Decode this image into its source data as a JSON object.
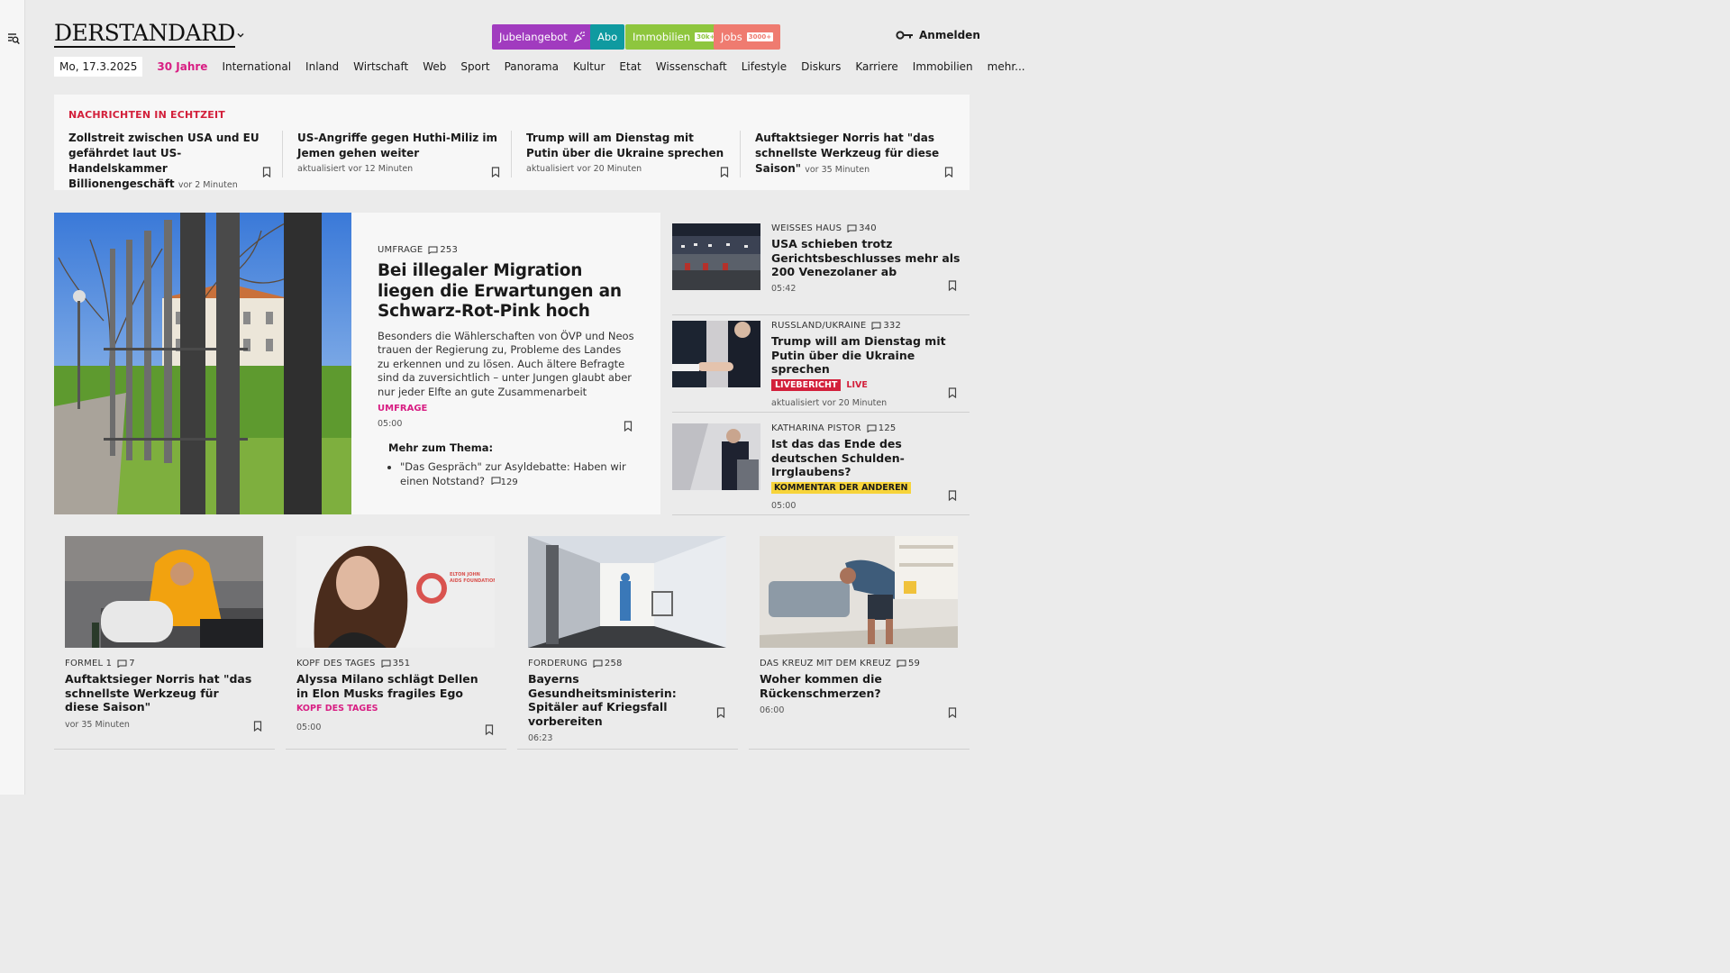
{
  "header": {
    "logo": "DERSTANDARD",
    "promos": [
      {
        "label": "Jubelangebot",
        "badge": "",
        "color": "#a13bbf"
      },
      {
        "label": "Abo",
        "badge": "",
        "color": "#0f9aa0"
      },
      {
        "label": "Immobilien",
        "badge": "30k+",
        "color": "#8ec63e"
      },
      {
        "label": "Jobs",
        "badge": "3000+",
        "color": "#ef7b70"
      }
    ],
    "login_label": "Anmelden"
  },
  "nav": {
    "date": "Mo, 17.3.2025",
    "items": [
      "30 Jahre",
      "International",
      "Inland",
      "Wirtschaft",
      "Web",
      "Sport",
      "Panorama",
      "Kultur",
      "Etat",
      "Wissenschaft",
      "Lifestyle",
      "Diskurs",
      "Karriere",
      "Immobilien",
      "mehr..."
    ]
  },
  "ticker": {
    "heading": "NACHRICHTEN IN ECHTZEIT",
    "items": [
      {
        "title": "Zollstreit zwischen USA und EU gefährdet laut US-Handelskammer Billionengeschäft",
        "time": "vor 2 Minuten"
      },
      {
        "title": "US-Angriffe gegen Huthi-Miliz im Jemen gehen weiter",
        "time": "aktualisiert vor 12 Minuten"
      },
      {
        "title": "Trump will am Dienstag mit Putin über die Ukraine sprechen",
        "time": "aktualisiert vor 20 Minuten"
      },
      {
        "title": "Auftaktsieger Norris hat \"das schnellste Werkzeug für diese Saison\"",
        "time": "vor 35 Minuten"
      }
    ]
  },
  "hero": {
    "kicker": "UMFRAGE",
    "comments": "253",
    "title": "Bei illegaler Migration liegen die Erwartungen an Schwarz-Rot-Pink hoch",
    "teaser": "Besonders die Wählerschaften von ÖVP und Neos trauen der Regierung zu, Probleme des Landes zu erkennen und zu lösen. Auch ältere Befragte sind da zuversichtlich – unter Jungen glaubt aber nur jeder Elfte an gute Zusammenarbeit",
    "tag": "UMFRAGE",
    "time": "05:00",
    "more_heading": "Mehr zum Thema:",
    "more_items": [
      {
        "text": "\"Das Gespräch\" zur Asyldebatte: Haben wir einen Notstand?",
        "comments": "129"
      }
    ]
  },
  "side_articles": [
    {
      "kicker": "WEISSES HAUS",
      "comments": "340",
      "title": "USA schieben trotz Gerichtsbeschlusses mehr als 200 Venezolaner ab",
      "time": "05:42"
    },
    {
      "kicker": "RUSSLAND/UKRAINE",
      "comments": "332",
      "title": "Trump will am Dienstag mit Putin über die Ukraine sprechen",
      "badge": "LIVEBERICHT",
      "live": "LIVE",
      "time": "aktualisiert vor 20 Minuten"
    },
    {
      "kicker": "KATHARINA PISTOR",
      "comments": "125",
      "title": "Ist das das Ende des deutschen Schulden-Irrglaubens?",
      "badge": "KOMMENTAR DER ANDEREN",
      "time": "05:00"
    }
  ],
  "cards": [
    {
      "kicker": "FORMEL 1",
      "comments": "7",
      "title": "Auftaktsieger Norris hat \"das schnellste Werkzeug für diese Saison\"",
      "tag": "",
      "time": "vor 35 Minuten"
    },
    {
      "kicker": "KOPF DES TAGES",
      "comments": "351",
      "title": "Alyssa Milano schlägt Dellen in Elon Musks fragiles Ego",
      "tag": "KOPF DES TAGES",
      "time": "05:00"
    },
    {
      "kicker": "FORDERUNG",
      "comments": "258",
      "title": "Bayerns Gesundheitsministerin: Spitäler auf Kriegsfall vorbereiten",
      "tag": "",
      "time": "06:23"
    },
    {
      "kicker": "DAS KREUZ MIT DEM KREUZ",
      "comments": "59",
      "title": "Woher kommen die Rückenschmerzen?",
      "tag": "",
      "time": "06:00"
    }
  ],
  "image_text": {
    "aids_foundation": "ELTON JOHN AIDS FOUNDATION"
  },
  "colors": {
    "accent_pink": "#d81e83",
    "live_red": "#d3203b",
    "comment_yellow": "#f7d43a"
  }
}
